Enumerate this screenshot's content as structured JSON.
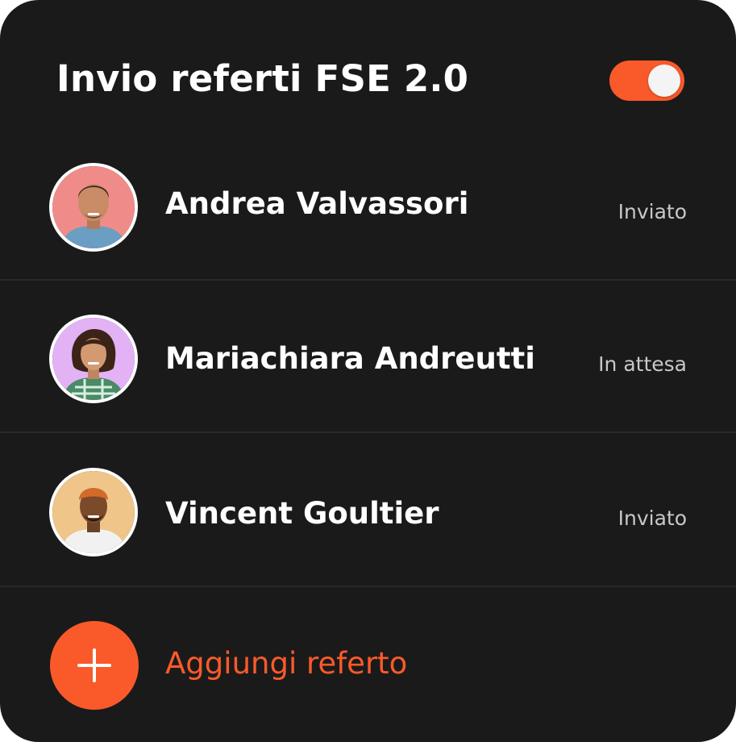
{
  "header": {
    "title": "Invio referti FSE 2.0",
    "toggle_on": true
  },
  "patients": [
    {
      "name": "Andrea Valvassori",
      "status": "Inviato",
      "avatar_bg": "#ef8c8a"
    },
    {
      "name": "Mariachiara Andreutti",
      "status": "In attesa",
      "avatar_bg": "#e3b2f5"
    },
    {
      "name": "Vincent Goultier",
      "status": "Inviato",
      "avatar_bg": "#efc58a"
    }
  ],
  "add": {
    "label": "Aggiungi referto",
    "icon": "plus-icon"
  },
  "colors": {
    "background": "#1b1a1b",
    "accent": "#fa5a2a",
    "text": "#ffffff",
    "muted": "#c9c7c9"
  }
}
